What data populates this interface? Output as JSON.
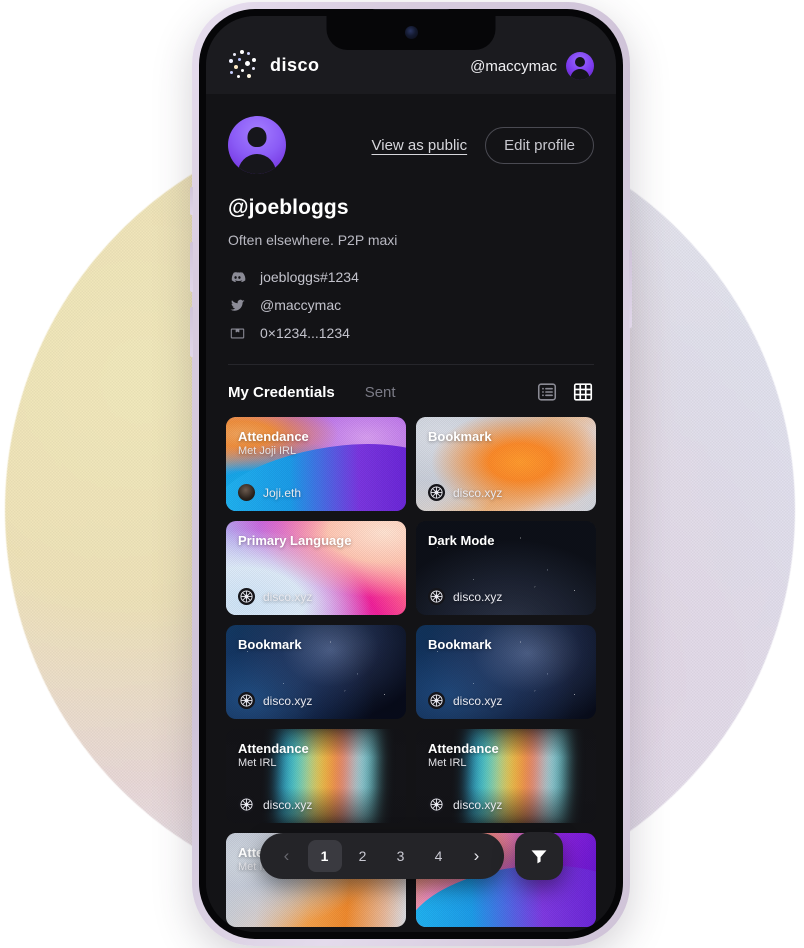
{
  "app": {
    "brand_name": "disco",
    "top_user": "@maccymac"
  },
  "profile": {
    "view_as_public": "View as public",
    "edit_profile": "Edit profile",
    "handle": "@joebloggs",
    "bio": "Often elsewhere. P2P maxi",
    "links": [
      {
        "icon": "discord-icon",
        "text": "joebloggs#1234"
      },
      {
        "icon": "twitter-icon",
        "text": "@maccymac"
      },
      {
        "icon": "wallet-icon",
        "text": "0×1234...1234"
      }
    ]
  },
  "tabs": {
    "my_credentials": "My Credentials",
    "sent": "Sent",
    "active": "My Credentials",
    "view_list_icon": "list-view-icon",
    "view_grid_icon": "grid-view-icon",
    "active_view": "grid"
  },
  "credentials": [
    {
      "title": "Attendance",
      "subtitle": "Met Joji IRL",
      "issuer": "Joji.eth",
      "art": "art-attend-joji",
      "badge": "photo"
    },
    {
      "title": "Bookmark",
      "subtitle": "",
      "issuer": "disco.xyz",
      "art": "art-bookmark-orange",
      "badge": "disco"
    },
    {
      "title": "Primary Language",
      "subtitle": "",
      "issuer": "disco.xyz",
      "art": "art-primary-lang",
      "badge": "disco"
    },
    {
      "title": "Dark Mode",
      "subtitle": "",
      "issuer": "disco.xyz",
      "art": "art-dark-mode",
      "badge": "disco"
    },
    {
      "title": "Bookmark",
      "subtitle": "",
      "issuer": "disco.xyz",
      "art": "art-nebula-a",
      "badge": "disco"
    },
    {
      "title": "Bookmark",
      "subtitle": "",
      "issuer": "disco.xyz",
      "art": "art-nebula-b",
      "badge": "disco"
    },
    {
      "title": "Attendance",
      "subtitle": "Met IRL",
      "issuer": "disco.xyz",
      "art": "art-aurora",
      "badge": "disco"
    },
    {
      "title": "Attendance",
      "subtitle": "Met IRL",
      "issuer": "disco.xyz",
      "art": "art-aurora",
      "badge": "disco"
    },
    {
      "title": "Attendance",
      "subtitle": "Met IRL",
      "issuer": "",
      "art": "art-attend-orange",
      "badge": "none"
    },
    {
      "title": "",
      "subtitle": "",
      "issuer": "",
      "art": "art-purple-wave",
      "badge": "none"
    }
  ],
  "pagination": {
    "prev_icon": "chevron-left-icon",
    "next_icon": "chevron-right-icon",
    "pages": [
      "1",
      "2",
      "3",
      "4"
    ],
    "current": "1",
    "filter_icon": "filter-icon"
  },
  "colors": {
    "accent_purple": "#7c3aed",
    "screen_bg": "#131316",
    "topbar_bg": "#1b1b1f",
    "pager_bg": "#242428",
    "active_page_bg": "#3a3a40",
    "phone_frame": "#d8ccdf"
  }
}
